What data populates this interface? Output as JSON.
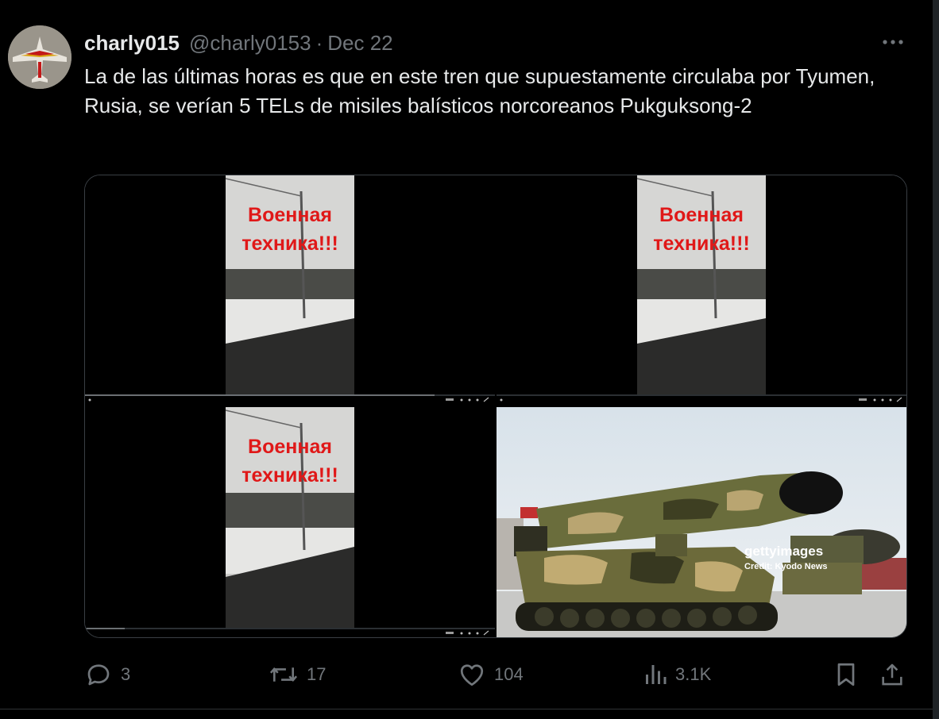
{
  "post": {
    "display_name": "charly015",
    "handle": "@charly0153",
    "separator": "·",
    "date": "Dec 22",
    "text": "La de las últimas horas es que en este tren que supuestamente circulaba por Tyumen, Rusia, se verían 5 TELs de misiles balísticos norcoreanos Pukguksong-2"
  },
  "media": {
    "video_caption_line1": "Военная",
    "video_caption_line2": "техника!!!",
    "getty_watermark": "gettyimages",
    "getty_credit": "Credit: Kyodo News"
  },
  "actions": {
    "replies": "3",
    "reposts": "17",
    "likes": "104",
    "views": "3.1K"
  },
  "icons": {
    "more": "more-icon",
    "reply": "reply-icon",
    "repost": "repost-icon",
    "like": "heart-icon",
    "views": "views-icon",
    "bookmark": "bookmark-icon",
    "share": "share-icon"
  },
  "colors": {
    "background": "#000000",
    "text_primary": "#e7e9ea",
    "text_secondary": "#71767b",
    "caption_red": "#e01818",
    "border": "#2f3336"
  }
}
